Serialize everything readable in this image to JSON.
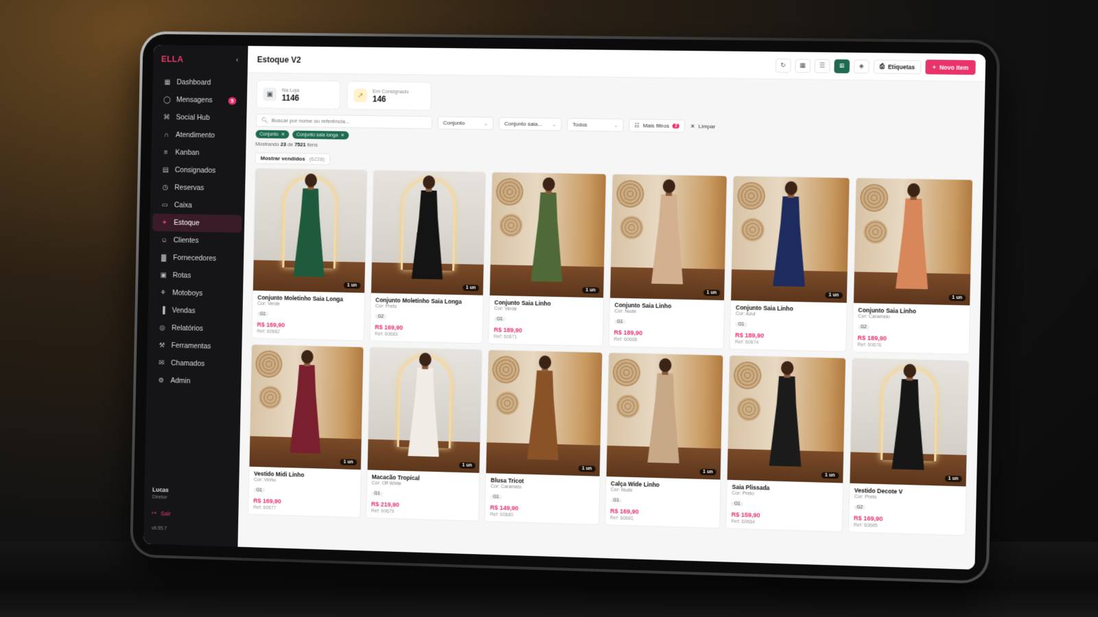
{
  "sidebar": {
    "brand": "ELLA",
    "items": [
      {
        "label": "Dashboard",
        "icon": "dashboard-icon"
      },
      {
        "label": "Mensagens",
        "icon": "message-icon",
        "badge": "5"
      },
      {
        "label": "Social Hub",
        "icon": "share-icon"
      },
      {
        "label": "Atendimento",
        "icon": "headset-icon"
      },
      {
        "label": "Kanban",
        "icon": "kanban-icon"
      },
      {
        "label": "Consignados",
        "icon": "calendar-icon"
      },
      {
        "label": "Reservas",
        "icon": "clock-icon"
      },
      {
        "label": "Caixa",
        "icon": "cash-icon"
      },
      {
        "label": "Estoque",
        "icon": "sparkle-icon",
        "active": true
      },
      {
        "label": "Clientes",
        "icon": "users-icon"
      },
      {
        "label": "Fornecedores",
        "icon": "factory-icon"
      },
      {
        "label": "Rotas",
        "icon": "truck-icon"
      },
      {
        "label": "Motoboys",
        "icon": "bike-icon"
      },
      {
        "label": "Vendas",
        "icon": "bar-chart-icon"
      },
      {
        "label": "Relatórios",
        "icon": "target-icon"
      },
      {
        "label": "Ferramentas",
        "icon": "wrench-icon"
      },
      {
        "label": "Chamados",
        "icon": "ticket-icon"
      },
      {
        "label": "Admin",
        "icon": "gear-icon"
      }
    ],
    "user": {
      "name": "Lucas",
      "role": "Diretor",
      "logout": "Sair",
      "version": "v6.55.7"
    }
  },
  "header": {
    "title": "Estoque V2",
    "labels_button": "Etiquetas",
    "new_button": "Novo Item"
  },
  "stats": [
    {
      "label": "Na Loja",
      "value": "1146"
    },
    {
      "label": "Em Consignado",
      "value": "146"
    }
  ],
  "filters": {
    "search_placeholder": "Buscar por nome ou referência...",
    "selects": [
      "Conjunto",
      "Conjunto saia...",
      "Todos"
    ],
    "more_filters": "Mais filtros",
    "more_count": "2",
    "clear": "Limpar",
    "chips": [
      "Conjunto",
      "Conjunto saia longa"
    ]
  },
  "count_line": {
    "prefix": "Mostrando",
    "shown": "23",
    "of": "de",
    "total": "7521",
    "suffix": "itens"
  },
  "show_sold": {
    "label": "Mostrar vendidos",
    "count": "(6228)"
  },
  "colors": {
    "accent": "#e8336b",
    "green": "#1f6b52",
    "sidebar": "#151518"
  },
  "products": [
    {
      "name": "Conjunto Moletinho Saia Longa",
      "color": "Cor: Verde",
      "size": "G1",
      "price": "R$ 169,90",
      "ref": "Ref: 60682",
      "unit": "1 un",
      "dress": "#1e5a3c",
      "scene": "arch"
    },
    {
      "name": "Conjunto Moletinho Saia Longa",
      "color": "Cor: Preto",
      "size": "G2",
      "price": "R$ 169,90",
      "ref": "Ref: 60683",
      "unit": "1 un",
      "dress": "#141414",
      "scene": "arch"
    },
    {
      "name": "Conjunto Saia Linho",
      "color": "Cor: Verde",
      "size": "G1",
      "price": "R$ 189,90",
      "ref": "Ref: 60671",
      "unit": "1 un",
      "dress": "#4f6a38",
      "scene": "boho"
    },
    {
      "name": "Conjunto Saia Linho",
      "color": "Cor: Nude",
      "size": "G1",
      "price": "R$ 189,90",
      "ref": "Ref: 60668",
      "unit": "1 un",
      "dress": "#d3b08e",
      "scene": "boho"
    },
    {
      "name": "Conjunto Saia Linho",
      "color": "Cor: Azul",
      "size": "G1",
      "price": "R$ 189,90",
      "ref": "Ref: 60674",
      "unit": "1 un",
      "dress": "#1e2b5e",
      "scene": "boho"
    },
    {
      "name": "Conjunto Saia Linho",
      "color": "Cor: Caramelo",
      "size": "G2",
      "price": "R$ 189,90",
      "ref": "Ref: 60676",
      "unit": "1 un",
      "dress": "#d7875a",
      "scene": "boho"
    },
    {
      "name": "Vestido Midi Linho",
      "color": "Cor: Vinho",
      "size": "G1",
      "price": "R$ 169,90",
      "ref": "Ref: 60677",
      "unit": "1 un",
      "dress": "#7a1f2e",
      "scene": "boho"
    },
    {
      "name": "Macacão Tropical",
      "color": "Cor: Off White",
      "size": "G1",
      "price": "R$ 219,90",
      "ref": "Ref: 60679",
      "unit": "1 un",
      "dress": "#f1ede6",
      "scene": "arch"
    },
    {
      "name": "Blusa Tricot",
      "color": "Cor: Caramelo",
      "size": "G1",
      "price": "R$ 149,90",
      "ref": "Ref: 60660",
      "unit": "1 un",
      "dress": "#8a5227",
      "scene": "boho"
    },
    {
      "name": "Calça Wide Linho",
      "color": "Cor: Nude",
      "size": "G1",
      "price": "R$ 169,90",
      "ref": "Ref: 60681",
      "unit": "1 un",
      "dress": "#c7a887",
      "scene": "boho"
    },
    {
      "name": "Saia Plissada",
      "color": "Cor: Preto",
      "size": "G1",
      "price": "R$ 159,90",
      "ref": "Ref: 60664",
      "unit": "1 un",
      "dress": "#1b1b1b",
      "scene": "boho"
    },
    {
      "name": "Vestido Decote V",
      "color": "Cor: Preto",
      "size": "G2",
      "price": "R$ 169,90",
      "ref": "Ref: 60685",
      "unit": "1 un",
      "dress": "#161616",
      "scene": "arch"
    }
  ]
}
